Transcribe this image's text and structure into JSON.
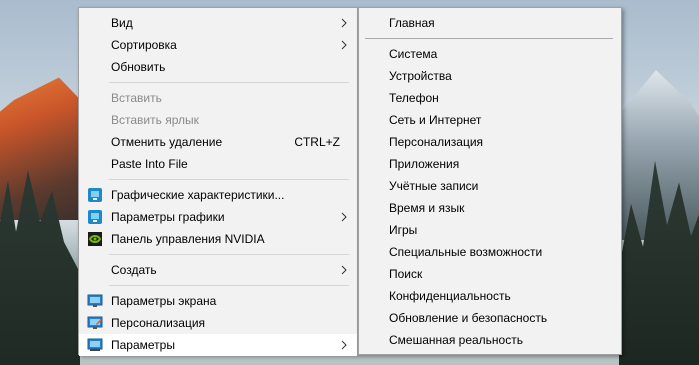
{
  "context_menu": {
    "group1": [
      {
        "label": "Вид",
        "submenu": true
      },
      {
        "label": "Сортировка",
        "submenu": true
      },
      {
        "label": "Обновить",
        "submenu": false
      }
    ],
    "group2": [
      {
        "label": "Вставить",
        "disabled": true
      },
      {
        "label": "Вставить ярлык",
        "disabled": true
      },
      {
        "label": "Отменить удаление",
        "shortcut": "CTRL+Z"
      },
      {
        "label": "Paste Into File"
      }
    ],
    "group3": [
      {
        "label": "Графические характеристики...",
        "icon": "intel-graphics-icon"
      },
      {
        "label": "Параметры графики",
        "icon": "intel-graphics-icon",
        "submenu": true
      },
      {
        "label": "Панель управления NVIDIA",
        "icon": "nvidia-icon"
      }
    ],
    "group4": [
      {
        "label": "Создать",
        "submenu": true
      }
    ],
    "group5": [
      {
        "label": "Параметры экрана",
        "icon": "display-icon"
      },
      {
        "label": "Персонализация",
        "icon": "personalization-icon"
      },
      {
        "label": "Параметры",
        "icon": "settings-icon",
        "submenu": true,
        "highlighted": true
      }
    ]
  },
  "submenu": {
    "top": "Главная",
    "items": [
      "Система",
      "Устройства",
      "Телефон",
      "Сеть и Интернет",
      "Персонализация",
      "Приложения",
      "Учётные записи",
      "Время и язык",
      "Игры",
      "Специальные возможности",
      "Поиск",
      "Конфиденциальность",
      "Обновление и безопасность",
      "Смешанная реальность"
    ]
  },
  "colors": {
    "menu_bg": "#f2f2f2",
    "hover_bg": "#ffffff",
    "disabled_text": "#8a8a8a"
  }
}
